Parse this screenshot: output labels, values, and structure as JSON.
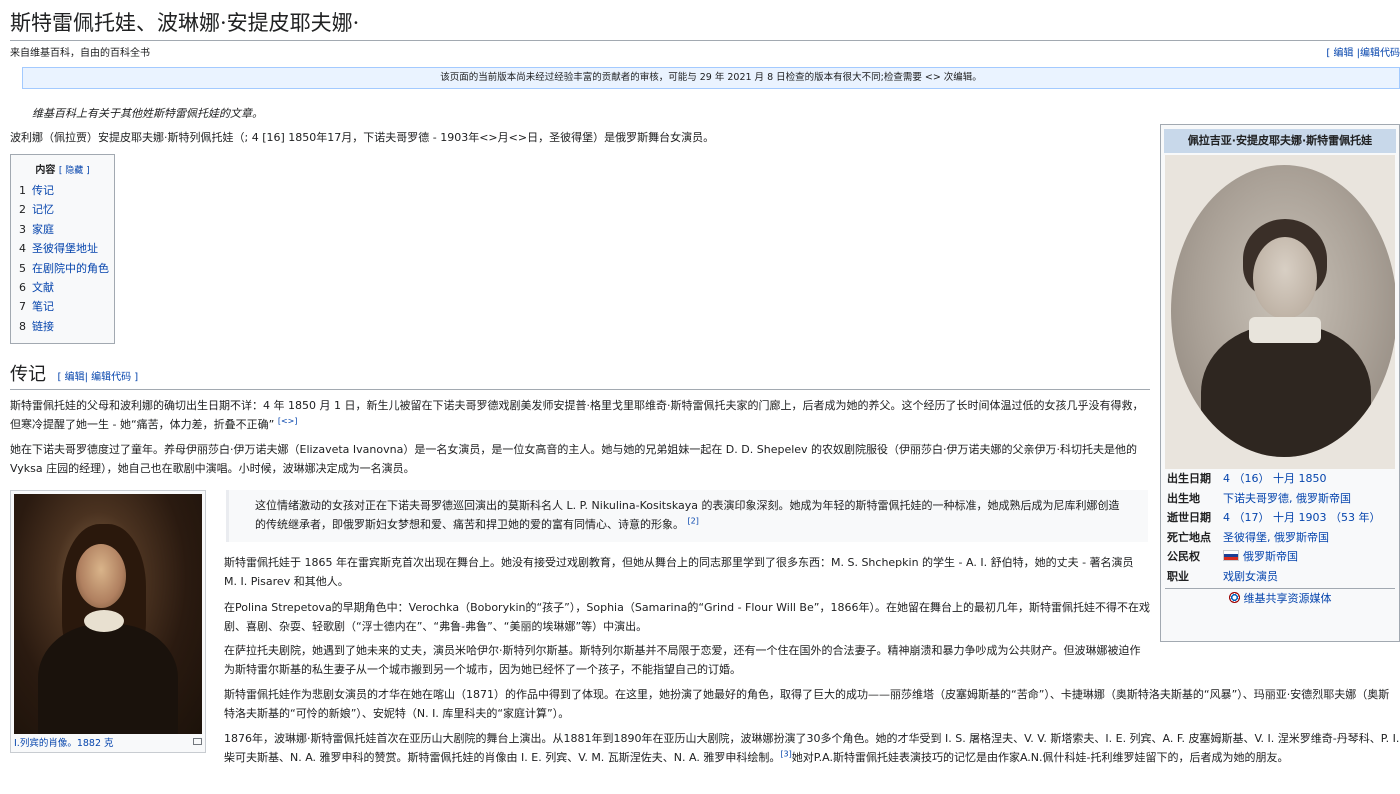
{
  "page": {
    "title": "斯特雷佩托娃、波琳娜·安提皮耶夫娜·",
    "tagline": "来自维基百科，自由的百科全书",
    "top_edit": "[ 编辑 |编辑代码",
    "review_notice": "该页面的当前版本尚未经过经验丰富的贡献者的审核，可能与 29 年 2021 月 8 日检查的版本有很大不同;检查需要 <> 次编辑。",
    "hatnote": "维基百科上有关于其他姓斯特雷佩托娃的文章。"
  },
  "lead": {
    "text": "波利娜（佩拉贾）安提皮耶夫娜·斯特列佩托娃（; 4 [16] 1850年17月，下诺夫哥罗德 - 1903年<>月<>日，圣彼得堡）是俄罗斯舞台女演员。"
  },
  "toc": {
    "title": "内容",
    "toggle": "[ 隐藏 ]",
    "items": [
      {
        "num": "1",
        "label": "传记"
      },
      {
        "num": "2",
        "label": "记忆"
      },
      {
        "num": "3",
        "label": "家庭"
      },
      {
        "num": "4",
        "label": "圣彼得堡地址"
      },
      {
        "num": "5",
        "label": "在剧院中的角色"
      },
      {
        "num": "6",
        "label": "文献"
      },
      {
        "num": "7",
        "label": "笔记"
      },
      {
        "num": "8",
        "label": "链接"
      }
    ]
  },
  "section_bio": {
    "heading": "传记",
    "edit": "[ 编辑| 编辑代码 ]",
    "p1": "斯特雷佩托娃的父母和波利娜的确切出生日期不详：4 年 1850 月 1 日，新生儿被留在下诺夫哥罗德戏剧美发师安提普·格里戈里耶维奇·斯特雷佩托夫家的门廊上，后者成为她的养父。这个经历了长时间体温过低的女孩几乎没有得救，但寒冷提醒了她一生 - 她“痛苦，体力差，折叠不正确”",
    "p1_ref": "[<>]",
    "p2": "她在下诺夫哥罗德度过了童年。养母伊丽莎白·伊万诺夫娜（Elizaveta Ivanovna）是一名女演员，是一位女高音的主人。她与她的兄弟姐妹一起在 D. D. Shepelev 的农奴剧院服役（伊丽莎白·伊万诺夫娜的父亲伊万·科切托夫是他的 Vyksa 庄园的经理），她自己也在歌剧中演唱。小时候，波琳娜决定成为一名演员。",
    "quote": "这位情绪激动的女孩对正在下诺夫哥罗德巡回演出的莫斯科名人 L. P. Nikulina-Kositskaya 的表演印象深刻。她成为年轻的斯特雷佩托娃的一种标准，她成熟后成为尼库利娜创造的传统继承者，即俄罗斯妇女梦想和爱、痛苦和捍卫她的爱的富有同情心、诗意的形象。",
    "quote_ref": "[2]",
    "p3": "斯特雷佩托娃于 1865 年在雷宾斯克首次出现在舞台上。她没有接受过戏剧教育，但她从舞台上的同志那里学到了很多东西：M. S. Shchepkin 的学生 - A. I. 舒伯特，她的丈夫 - 著名演员 M. I. Pisarev 和其他人。",
    "p4": "在Polina Strepetova的早期角色中：Verochka（Boborykin的“孩子”），Sophia（Samarina的“Grind - Flour Will Be”，1866年）。在她留在舞台上的最初几年，斯特雷佩托娃不得不在戏剧、喜剧、杂耍、轻歌剧（“浮士德内在”、“弗鲁-弗鲁”、“美丽的埃琳娜”等）中演出。",
    "p5": "在萨拉托夫剧院，她遇到了她未来的丈夫，演员米哈伊尔·斯特列尔斯基。斯特列尔斯基并不局限于恋爱，还有一个住在国外的合法妻子。精神崩溃和暴力争吵成为公共财产。但波琳娜被迫作为斯特雷尔斯基的私生妻子从一个城市搬到另一个城市，因为她已经怀了一个孩子，不能指望自己的订婚。",
    "p6": "斯特雷佩托娃作为悲剧女演员的才华在她在喀山（1871）的作品中得到了体现。在这里，她扮演了她最好的角色，取得了巨大的成功——丽莎维塔（皮塞姆斯基的“苦命”）、卡捷琳娜（奥斯特洛夫斯基的“风暴”）、玛丽亚·安德烈耶夫娜（奥斯特洛夫斯基的“可怜的新娘”）、安妮特（N. I. 库里科夫的“家庭计算”）。",
    "p7": "1876年，波琳娜·斯特雷佩托娃首次在亚历山大剧院的舞台上演出。从1881年到1890年在亚历山大剧院，波琳娜扮演了30多个角色。她的才华受到 I. S. 屠格涅夫、V. V. 斯塔索夫、I. E. 列宾、A. F. 皮塞姆斯基、V. I. 涅米罗维奇-丹琴科、P. I. 柴可夫斯基、N. A. 雅罗申科的赞赏。斯特雷佩托娃的肖像由 I. E. 列宾、V. M. 瓦斯涅佐夫、N. A. 雅罗申科绘制。",
    "p7_ref": "[3]",
    "p7_tail": "她对P.A.斯特雷佩托娃表演技巧的记忆是由作家A.N.佩什科娃-托利维罗娃留下的，后者成为她的朋友。"
  },
  "thumb": {
    "caption": "I.列宾的肖像。1882 克"
  },
  "infobox": {
    "title": "佩拉吉亚·安提皮耶夫娜·斯特雷佩托娃",
    "rows": [
      {
        "label": "出生日期",
        "value": "4 （16） 十月 1850"
      },
      {
        "label": "出生地",
        "value": "下诺夫哥罗德, 俄罗斯帝国"
      },
      {
        "label": "逝世日期",
        "value": "4 （17） 十月 1903 （53 年）"
      },
      {
        "label": "死亡地点",
        "value": "圣彼得堡, 俄罗斯帝国"
      },
      {
        "label": "公民权",
        "value": "俄罗斯帝国"
      },
      {
        "label": "职业",
        "value": "戏剧女演员"
      }
    ],
    "commons": "维基共享资源媒体"
  },
  "colors": {
    "link": "#0645ad",
    "redlink": "#ba0000",
    "infobox_title_bg": "#c8d8ea",
    "notice_bg": "#eaf3ff"
  }
}
